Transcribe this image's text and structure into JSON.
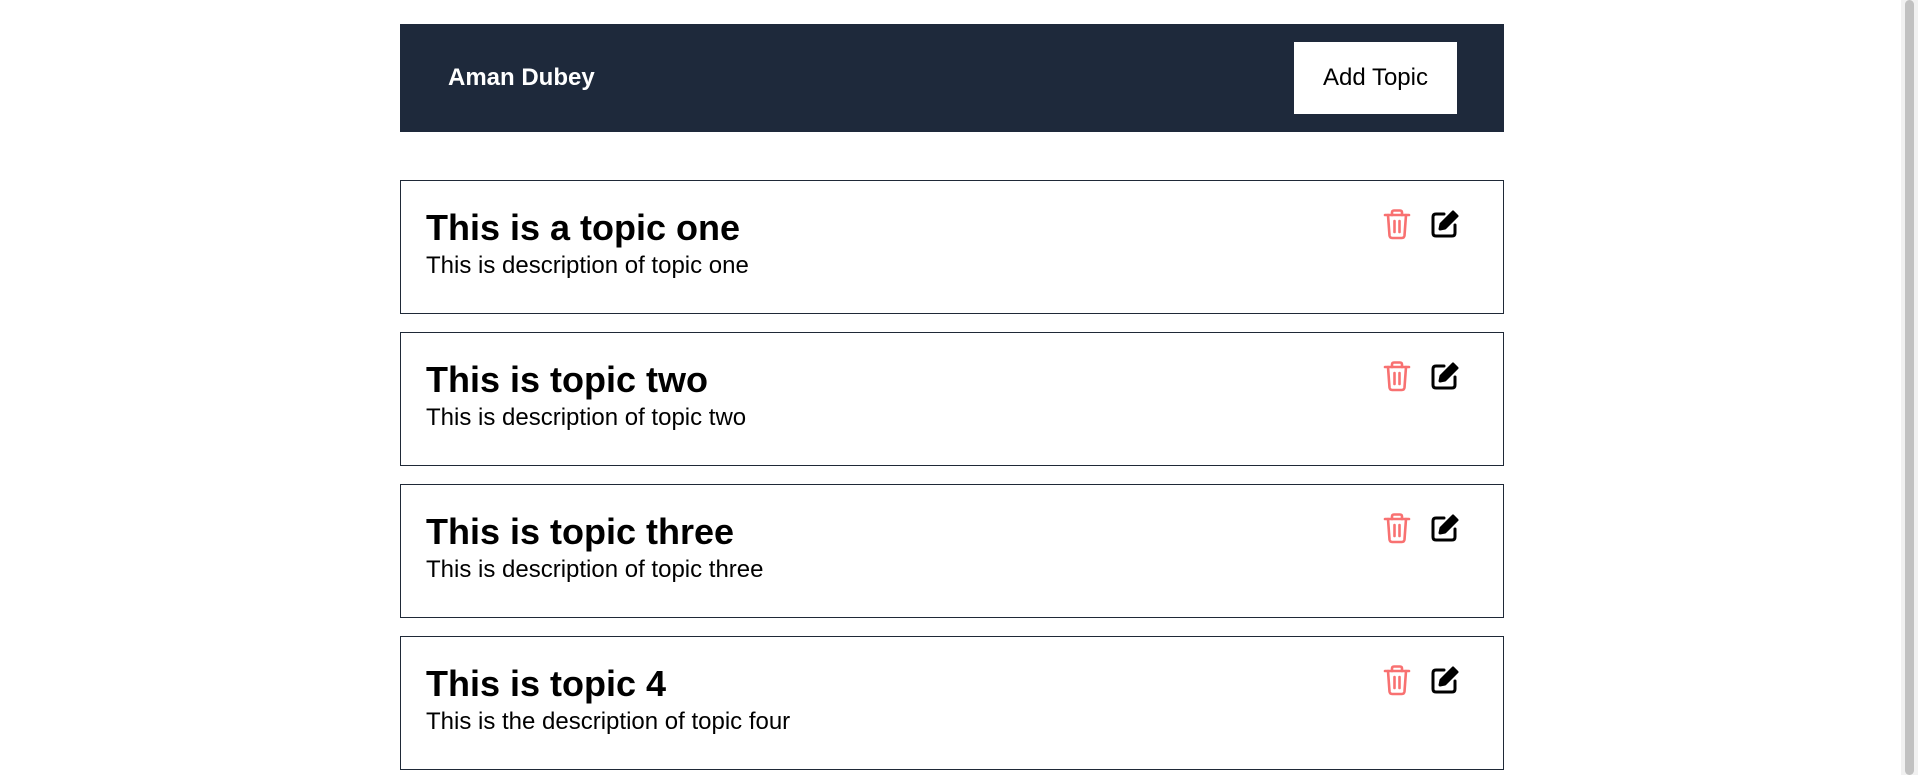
{
  "navbar": {
    "brand": "Aman Dubey",
    "add_topic_label": "Add Topic"
  },
  "topics": [
    {
      "title": "This is a topic one",
      "description": "This is description of topic one"
    },
    {
      "title": "This is topic two",
      "description": "This is description of topic two"
    },
    {
      "title": "This is topic three",
      "description": "This is description of topic three"
    },
    {
      "title": "This is topic 4",
      "description": "This is the description of topic four"
    }
  ],
  "icons": {
    "delete": "trash-icon",
    "edit": "edit-icon"
  },
  "colors": {
    "navbar_bg": "#1e293b",
    "delete_icon": "#f87171",
    "edit_icon": "#000000",
    "card_border": "#1f2937"
  }
}
